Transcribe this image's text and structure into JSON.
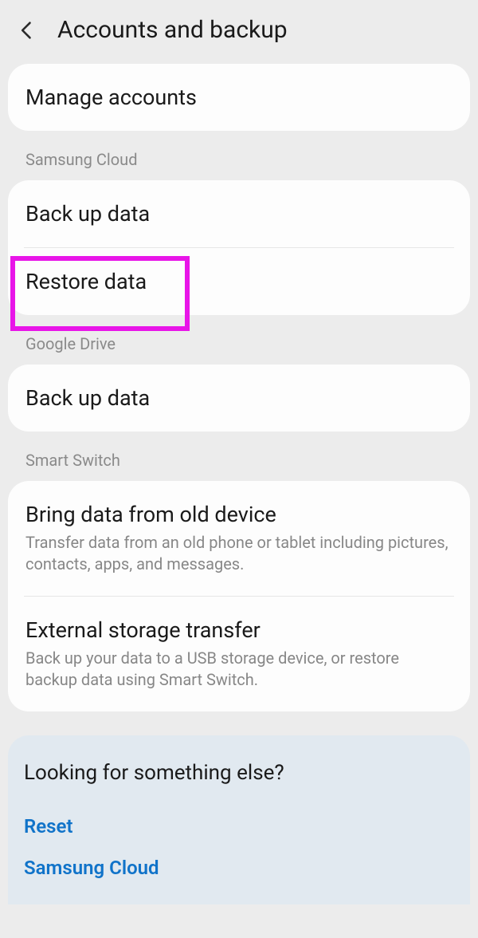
{
  "header": {
    "title": "Accounts and backup"
  },
  "manage": {
    "label": "Manage accounts"
  },
  "sections": {
    "samsung_cloud": {
      "header": "Samsung Cloud",
      "backup": "Back up data",
      "restore": "Restore data"
    },
    "google_drive": {
      "header": "Google Drive",
      "backup": "Back up data"
    },
    "smart_switch": {
      "header": "Smart Switch",
      "bring_title": "Bring data from old device",
      "bring_subtitle": "Transfer data from an old phone or tablet including pictures, contacts, apps, and messages.",
      "external_title": "External storage transfer",
      "external_subtitle": "Back up your data to a USB storage device, or restore backup data using Smart Switch."
    }
  },
  "footer": {
    "title": "Looking for something else?",
    "links": {
      "reset": "Reset",
      "samsung_cloud": "Samsung Cloud"
    }
  }
}
